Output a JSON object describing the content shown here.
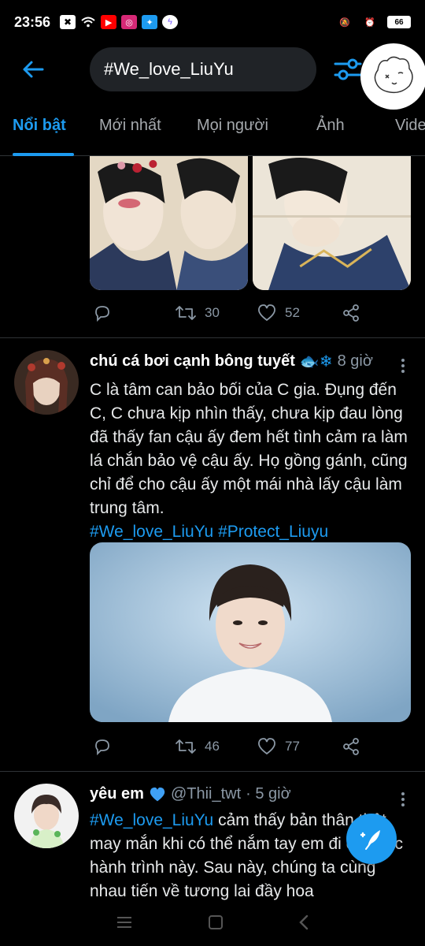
{
  "status_bar": {
    "time": "23:56",
    "battery": "66"
  },
  "search": {
    "query": "#We_love_LiuYu"
  },
  "tabs": [
    {
      "label": "Nổi bật"
    },
    {
      "label": "Mới nhất"
    },
    {
      "label": "Mọi người"
    },
    {
      "label": "Ảnh"
    },
    {
      "label": "Vide"
    }
  ],
  "tweet1": {
    "replies": "",
    "retweets": "30",
    "likes": "52"
  },
  "tweet2": {
    "author": "chú cá bơi cạnh bông tuyết",
    "emoji": "🐟❄",
    "time": "8 giờ",
    "text": "C là tâm can bảo bối của C gia. Đụng đến C, C chưa kịp nhìn thấy, chưa kịp đau lòng đã thấy fan cậu ấy đem hết tình cảm ra làm lá chắn bảo vệ cậu ấy. Họ gồng gánh, cũng chỉ để cho cậu ấy một mái nhà lấy cậu làm trung tâm.",
    "hashtag1": "#We_love_LiuYu",
    "hashtag2": "#Protect_Liuyu",
    "retweets": "46",
    "likes": "77"
  },
  "tweet3": {
    "author": "yêu em",
    "handle": "@Thii_twt",
    "time": "· 5 giờ",
    "hashtag": "#We_love_LiuYu",
    "text": " cảm thấy bản thân thật may mắn khi có thể nắm tay em đi cả cuộc hành trình này. Sau này, chúng ta cùng nhau tiến về tương lai đầy hoa"
  },
  "colors": {
    "accent": "#1d9bf0",
    "background": "#000000",
    "secondary_text": "#8b98a5"
  }
}
